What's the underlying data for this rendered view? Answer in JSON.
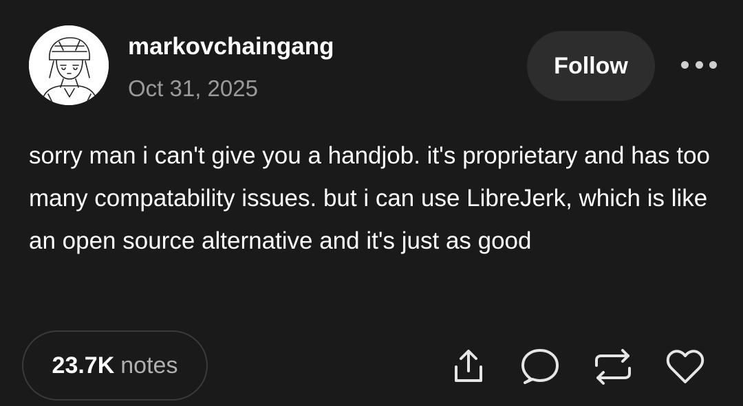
{
  "post": {
    "username": "markovchaingang",
    "date": "Oct 31, 2025",
    "follow_label": "Follow",
    "body": "sorry man i can't give you a handjob. it's proprietary and has too many compatability issues. but i can use LibreJerk, which is like an open source alternative and it's just as good",
    "notes_count": "23.7K",
    "notes_label": "notes"
  },
  "icons": {
    "more": "more-options-icon",
    "share": "share-icon",
    "reply": "reply-icon",
    "reblog": "reblog-icon",
    "like": "heart-icon"
  },
  "colors": {
    "background": "#1a1a1a",
    "text": "#ffffff",
    "muted": "#9a9a9a",
    "button": "#2d2d2d"
  }
}
